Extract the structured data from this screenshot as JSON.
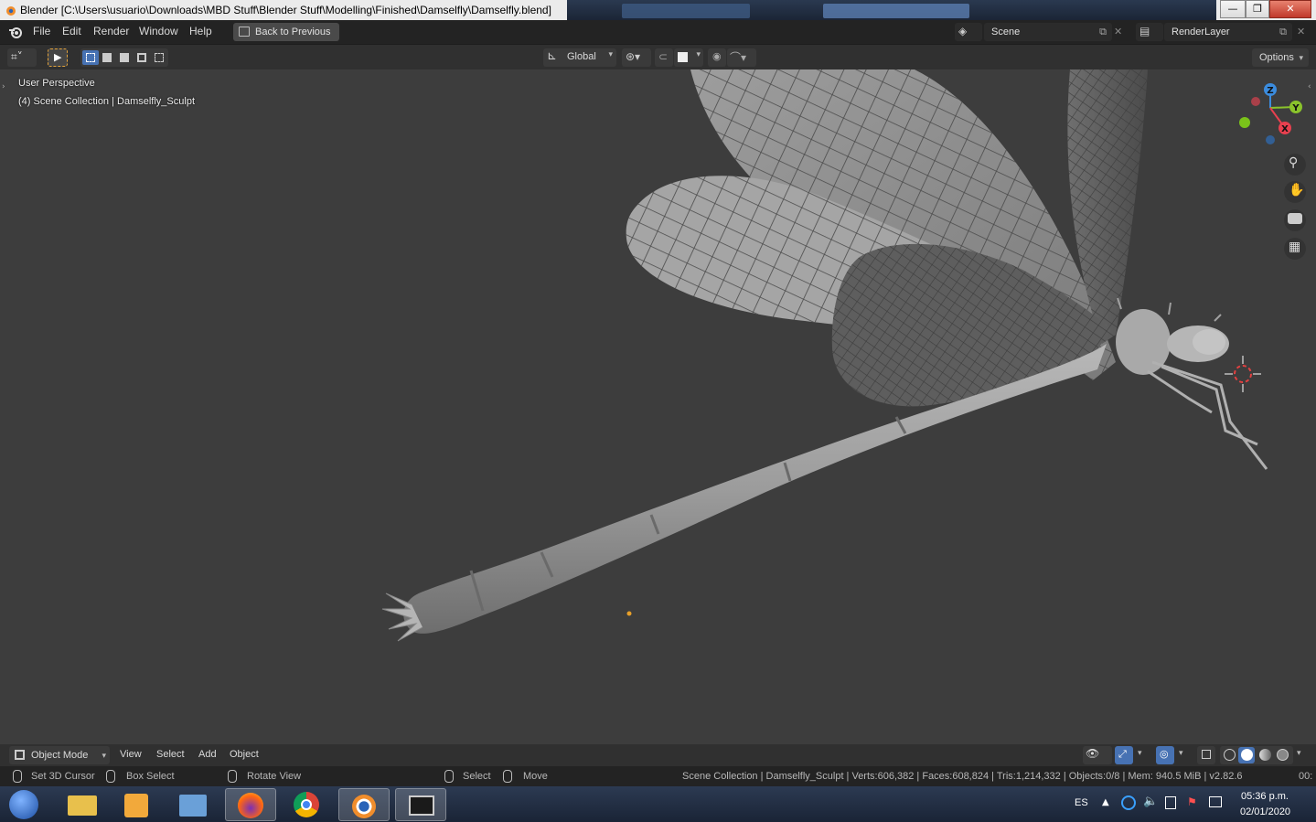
{
  "window": {
    "title": "Blender [C:\\Users\\usuario\\Downloads\\MBD Stuff\\Blender Stuff\\Modelling\\Finished\\Damselfly\\Damselfly.blend]",
    "controls": {
      "minimize": "—",
      "maximize": "❐",
      "close": "✕"
    }
  },
  "menubar": {
    "items": [
      "File",
      "Edit",
      "Render",
      "Window",
      "Help"
    ],
    "back_button": "Back to Previous",
    "scene": "Scene",
    "render_layer": "RenderLayer"
  },
  "tool_header": {
    "orientation": "Global",
    "options": "Options"
  },
  "viewport": {
    "view_name": "User Perspective",
    "collection": "(4) Scene Collection | Damselfly_Sculpt",
    "gizmo": {
      "z": "Z",
      "y": "Y",
      "x": "X"
    }
  },
  "bottom_header": {
    "mode": "Object Mode",
    "menus": [
      "View",
      "Select",
      "Add",
      "Object"
    ]
  },
  "statusbar": {
    "set_cursor": "Set 3D Cursor",
    "box_select": "Box Select",
    "rotate_view": "Rotate View",
    "select": "Select",
    "move": "Move",
    "stats": "Scene Collection | Damselfly_Sculpt | Verts:606,382 | Faces:608,824 | Tris:1,214,332 | Objects:0/8 | Mem: 940.5 MiB | v2.82.6",
    "extra": "00:"
  },
  "taskbar": {
    "language": "ES",
    "time": "05:36 p.m.",
    "date": "02/01/2020"
  },
  "colors": {
    "viewport_bg": "#3d3d3d",
    "accent_blue": "#4772b3",
    "gizmo_x": "#e8404f",
    "gizmo_y": "#8ac32b",
    "gizmo_z": "#3b8cde"
  }
}
